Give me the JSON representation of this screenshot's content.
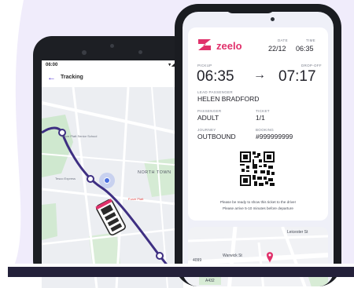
{
  "colors": {
    "accent": "#5b3fd6",
    "brand": "#e0316b",
    "route": "#3e2f82",
    "background_shape": "#f0ecfb",
    "bottom_bar": "#24213a"
  },
  "tracking": {
    "status_time": "06:00",
    "status_icons": "▾◢▮",
    "back_icon": "arrow-left-icon",
    "title": "Tracking",
    "map_labels": {
      "school": "Furze Platt Senior School",
      "express": "Tesco Express",
      "town": "NORTH TOWN",
      "poi": "Furze Platt"
    }
  },
  "ticket": {
    "brand": "zeelo",
    "date_label": "DATE",
    "time_label": "TIME",
    "date": "22/12",
    "time": "06:35",
    "pickup_label": "PICKUP",
    "dropoff_label": "DROP-OFF",
    "pickup_time": "06:35",
    "arrow": "→",
    "dropoff_time": "07:17",
    "lead_passenger_label": "LEAD PASSENGER",
    "lead_passenger": "HELEN BRADFORD",
    "passenger_label": "PASSENGER",
    "passenger": "ADULT",
    "ticket_label": "TICKET",
    "ticket": "1/1",
    "journey_label": "JOURNEY",
    "journey": "OUTBOUND",
    "booking_label": "BOOKING",
    "booking": "#999999999",
    "notice_line1": "Please be ready to show this ticket to the driver",
    "notice_line2": "Please arrive 5-10 minutes before departure"
  },
  "map2_labels": {
    "road1": "Leicester St",
    "road2": "Warwick St",
    "road3": "4099",
    "road4": "A432"
  }
}
